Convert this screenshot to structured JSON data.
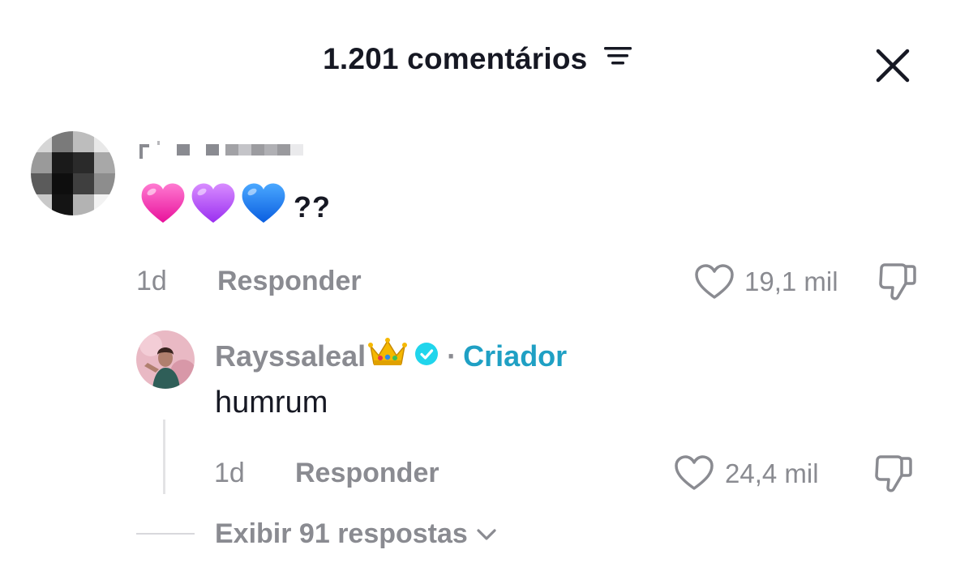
{
  "header": {
    "title": "1.201 comentários",
    "sort_icon": "sort-lines-icon",
    "close_icon": "close-icon"
  },
  "comments": [
    {
      "avatar": "pixelated-avatar",
      "username": "",
      "text": "??",
      "emojis": [
        "pink-heart",
        "purple-heart",
        "blue-heart"
      ],
      "time": "1d",
      "reply_label": "Responder",
      "likes": "19,1 mil"
    }
  ],
  "reply": {
    "username": "Rayssaleal",
    "badge": "crown-emoji",
    "verified": true,
    "separator": "·",
    "creator_label": "Criador",
    "text": "humrum",
    "time": "1d",
    "reply_label": "Responder",
    "likes": "24,4 mil"
  },
  "view_replies": "Exibir 91 respostas",
  "colors": {
    "accent_creator": "#1FA0C4",
    "verified": "#20D5EC",
    "muted": "#8A8B91",
    "text": "#161823"
  }
}
